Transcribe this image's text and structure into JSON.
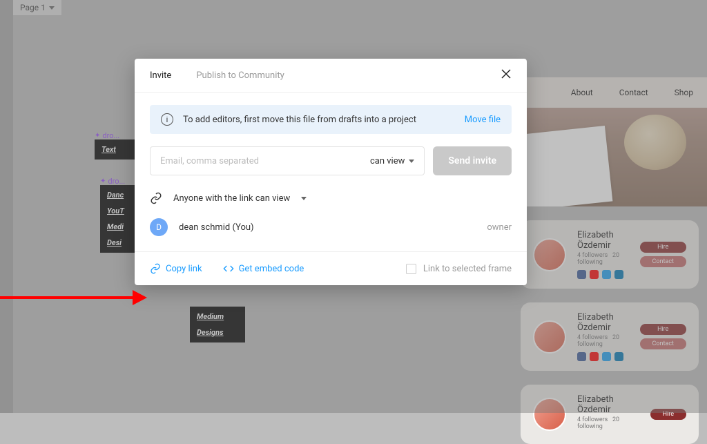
{
  "page_label": "Page 1",
  "bg_components": {
    "label1": "dro...",
    "text_item": "Text",
    "label2": "dro...",
    "lines1": [
      "Danc",
      "YouT",
      "Medi",
      "Desi"
    ],
    "lines2": [
      "Medium",
      "Designs"
    ]
  },
  "preview": {
    "nav": [
      "About",
      "Contact",
      "Shop"
    ],
    "card_name": "Elizabeth Özdemir",
    "card_meta_followers": "4 followers",
    "card_meta_following": "20 following",
    "btn_hire": "Hire",
    "btn_contact": "Contact"
  },
  "modal": {
    "tabs": {
      "invite": "Invite",
      "publish": "Publish to Community"
    },
    "banner_text": "To add editors, first move this file from drafts into a project",
    "move_file": "Move file",
    "email_placeholder": "Email, comma separated",
    "perm_label": "can view",
    "send_label": "Send invite",
    "link_access": "Anyone with the link can view",
    "user_name": "dean schmid (You)",
    "user_initial": "D",
    "user_role": "owner",
    "copy_link": "Copy link",
    "embed_code": "Get embed code",
    "link_frame": "Link to selected frame"
  }
}
